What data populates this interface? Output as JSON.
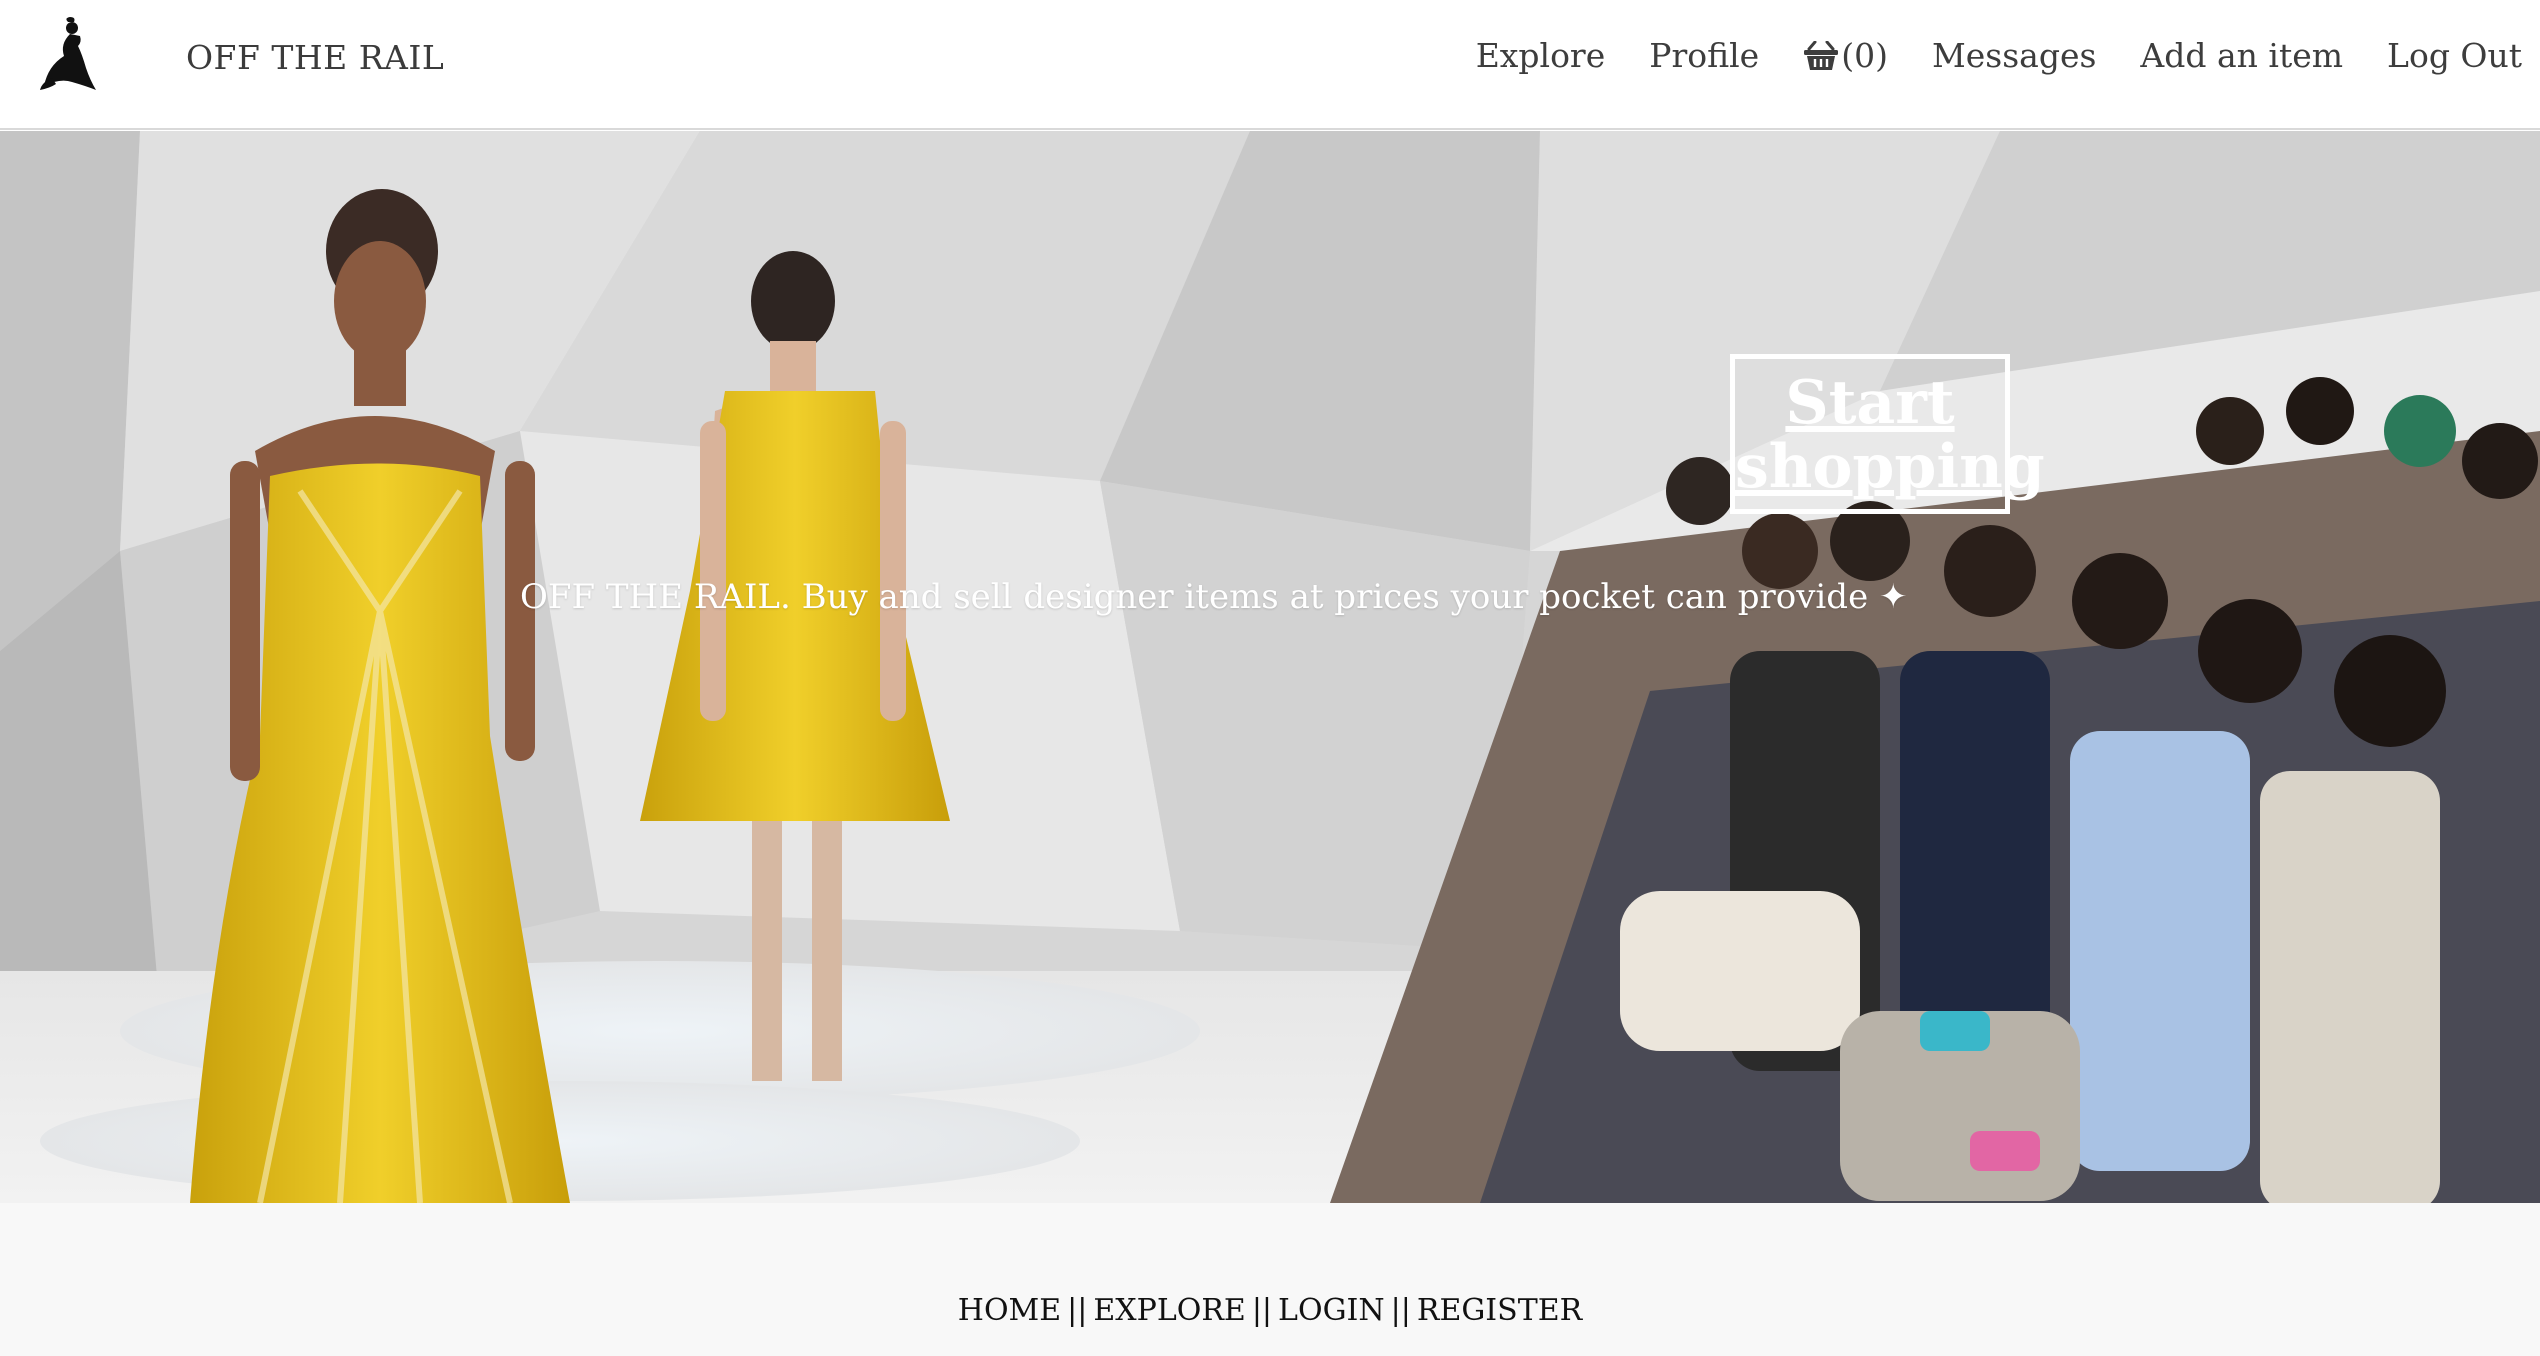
{
  "header": {
    "brand": "OFF THE RAIL",
    "logo_icon": "dancer-silhouette-icon",
    "nav": {
      "explore": "Explore",
      "profile": "Profile",
      "basket_icon": "basket-icon",
      "basket_count": "(0)",
      "messages": "Messages",
      "add_item": "Add an item",
      "logout": "Log Out"
    }
  },
  "hero": {
    "tagline": "OFF THE RAIL. Buy and sell designer items at prices your pocket can provide ✦",
    "cta": "Start shopping"
  },
  "footer": {
    "home": "HOME",
    "explore": "EXPLORE",
    "login": "LOGIN",
    "register": "REGISTER",
    "separator": "||"
  },
  "colors": {
    "nav_text": "#3d3d3d",
    "footer_bg": "#f8f8f8",
    "dress_yellow": "#e8c21c",
    "hero_cta": "#ffffff"
  }
}
